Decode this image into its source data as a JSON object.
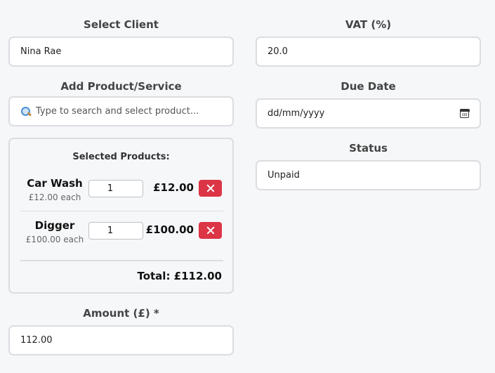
{
  "client": {
    "label": "Select Client",
    "value": "Nina Rae"
  },
  "vat": {
    "label": "VAT (%)",
    "value": "20.0"
  },
  "add_product": {
    "label": "Add Product/Service",
    "placeholder": "Type to search and select product..."
  },
  "due_date": {
    "label": "Due Date",
    "value": "dd/mm/yyyy"
  },
  "status": {
    "label": "Status",
    "value": "Unpaid"
  },
  "selected_products": {
    "title": "Selected Products:",
    "items": [
      {
        "name": "Car Wash",
        "unit_price": "£12.00 each",
        "quantity": "1",
        "line_total": "£12.00"
      },
      {
        "name": "Digger",
        "unit_price": "£100.00 each",
        "quantity": "1",
        "line_total": "£100.00"
      }
    ],
    "total": "Total: £112.00"
  },
  "amount": {
    "label": "Amount (£) *",
    "value": "112.00"
  },
  "icons": {
    "search": "search-icon",
    "calendar": "calendar-icon",
    "remove": "close-icon"
  },
  "colors": {
    "remove_button": "#dc3545"
  }
}
